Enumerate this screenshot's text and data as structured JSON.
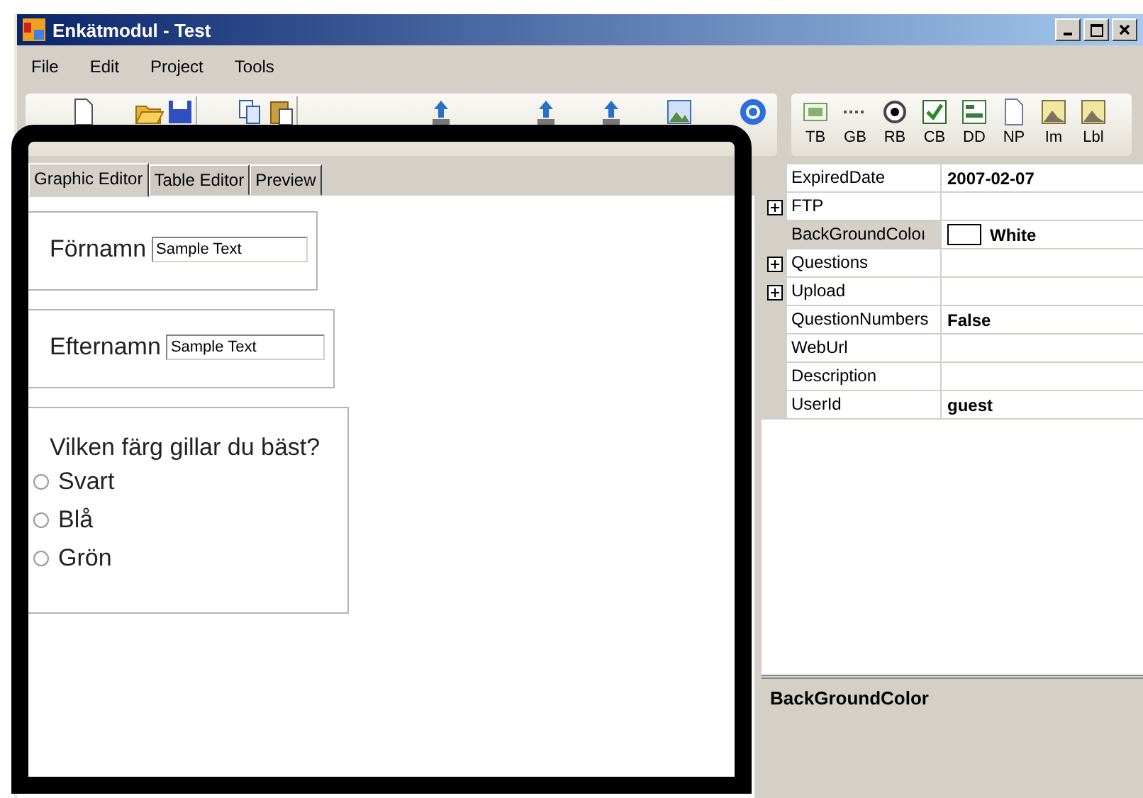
{
  "window": {
    "title": "Enkätmodul - Test"
  },
  "menu": [
    "File",
    "Edit",
    "Project",
    "Tools"
  ],
  "widget_toolbar": [
    "TB",
    "GB",
    "RB",
    "CB",
    "DD",
    "NP",
    "Im",
    "Lbl"
  ],
  "tabs": [
    {
      "label": "Graphic Editor",
      "selected": true
    },
    {
      "label": "Table Editor",
      "selected": false
    },
    {
      "label": "Preview",
      "selected": false
    }
  ],
  "questions": [
    {
      "kind": "text",
      "label": "Förnamn",
      "value": "Sample Text"
    },
    {
      "kind": "text",
      "label": "Efternamn",
      "value": "Sample Text"
    },
    {
      "kind": "radio",
      "question": "Vilken färg gillar du bäst?",
      "options": [
        {
          "label": "Svart",
          "selected": false
        },
        {
          "label": "Blå",
          "selected": false
        },
        {
          "label": "Grön",
          "selected": false
        }
      ]
    }
  ],
  "properties": [
    {
      "name": "ExpiredDate",
      "value": "2007-02-07",
      "expandable": false,
      "selected": false
    },
    {
      "name": "FTP",
      "expandable": true,
      "selected": false
    },
    {
      "name": "BackGroundColoı",
      "value": "White",
      "color": "#ffffff",
      "expandable": false,
      "selected": true
    },
    {
      "name": "Questions",
      "expandable": true,
      "selected": false
    },
    {
      "name": "Upload",
      "expandable": true,
      "selected": false
    },
    {
      "name": "QuestionNumbers",
      "value": "False",
      "expandable": false,
      "selected": false
    },
    {
      "name": "WebUrl",
      "expandable": false,
      "selected": false
    },
    {
      "name": "Description",
      "expandable": false,
      "selected": false
    },
    {
      "name": "UserId",
      "value": "guest",
      "expandable": false,
      "selected": false
    }
  ],
  "description": {
    "title": "BackGroundColor"
  }
}
